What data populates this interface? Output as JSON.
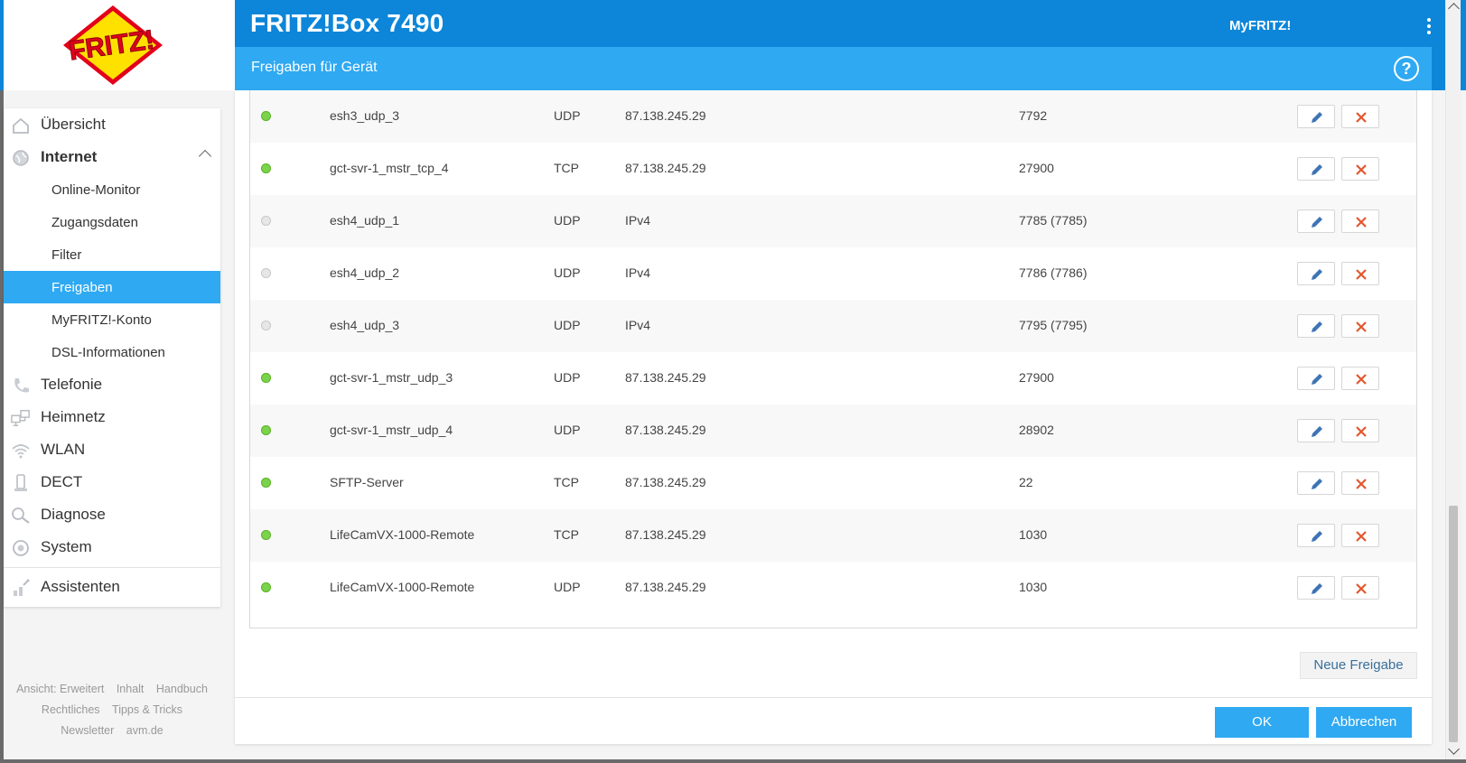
{
  "header": {
    "app_title": "FRITZ!Box 7490",
    "myfritz_label": "MyFRITZ!",
    "logo_text": "FRITZ!",
    "accent_color": "#0d86d9"
  },
  "dialog": {
    "title": "Freigaben für Gerät",
    "help_label": "?"
  },
  "sidebar": {
    "items": [
      {
        "label": "Übersicht",
        "icon": "home-icon"
      },
      {
        "label": "Internet",
        "icon": "globe-icon"
      },
      {
        "label": "Telefonie",
        "icon": "phone-icon"
      },
      {
        "label": "Heimnetz",
        "icon": "network-icon"
      },
      {
        "label": "WLAN",
        "icon": "wifi-icon"
      },
      {
        "label": "DECT",
        "icon": "dect-icon"
      },
      {
        "label": "Diagnose",
        "icon": "diagnose-icon"
      },
      {
        "label": "System",
        "icon": "system-icon"
      },
      {
        "label": "Assistenten",
        "icon": "wizard-icon"
      }
    ],
    "internet_sub": [
      {
        "label": "Online-Monitor"
      },
      {
        "label": "Zugangsdaten"
      },
      {
        "label": "Filter"
      },
      {
        "label": "Freigaben"
      },
      {
        "label": "MyFRITZ!-Konto"
      },
      {
        "label": "DSL-Informationen"
      }
    ]
  },
  "footer": {
    "view_label": "Ansicht: Erweitert",
    "content": "Inhalt",
    "manual": "Handbuch",
    "legal": "Rechtliches",
    "tips": "Tipps & Tricks",
    "newsletter": "Newsletter",
    "site": "avm.de"
  },
  "shares": [
    {
      "status": "on",
      "name": "esh3_udp_3",
      "protocol": "UDP",
      "address": "87.138.245.29",
      "port": "7792"
    },
    {
      "status": "on",
      "name": "gct-svr-1_mstr_tcp_4",
      "protocol": "TCP",
      "address": "87.138.245.29",
      "port": "27900"
    },
    {
      "status": "off",
      "name": "esh4_udp_1",
      "protocol": "UDP",
      "address": "IPv4",
      "port": "7785 (7785)"
    },
    {
      "status": "off",
      "name": "esh4_udp_2",
      "protocol": "UDP",
      "address": "IPv4",
      "port": "7786 (7786)"
    },
    {
      "status": "off",
      "name": "esh4_udp_3",
      "protocol": "UDP",
      "address": "IPv4",
      "port": "7795 (7795)"
    },
    {
      "status": "on",
      "name": "gct-svr-1_mstr_udp_3",
      "protocol": "UDP",
      "address": "87.138.245.29",
      "port": "27900"
    },
    {
      "status": "on",
      "name": "gct-svr-1_mstr_udp_4",
      "protocol": "UDP",
      "address": "87.138.245.29",
      "port": "28902"
    },
    {
      "status": "on",
      "name": "SFTP-Server",
      "protocol": "TCP",
      "address": "87.138.245.29",
      "port": "22"
    },
    {
      "status": "on",
      "name": "LifeCamVX-1000-Remote",
      "protocol": "TCP",
      "address": "87.138.245.29",
      "port": "1030"
    },
    {
      "status": "on",
      "name": "LifeCamVX-1000-Remote",
      "protocol": "UDP",
      "address": "87.138.245.29",
      "port": "1030"
    }
  ],
  "actions": {
    "new_share": "Neue Freigabe",
    "ok": "OK",
    "cancel": "Abbrechen"
  }
}
